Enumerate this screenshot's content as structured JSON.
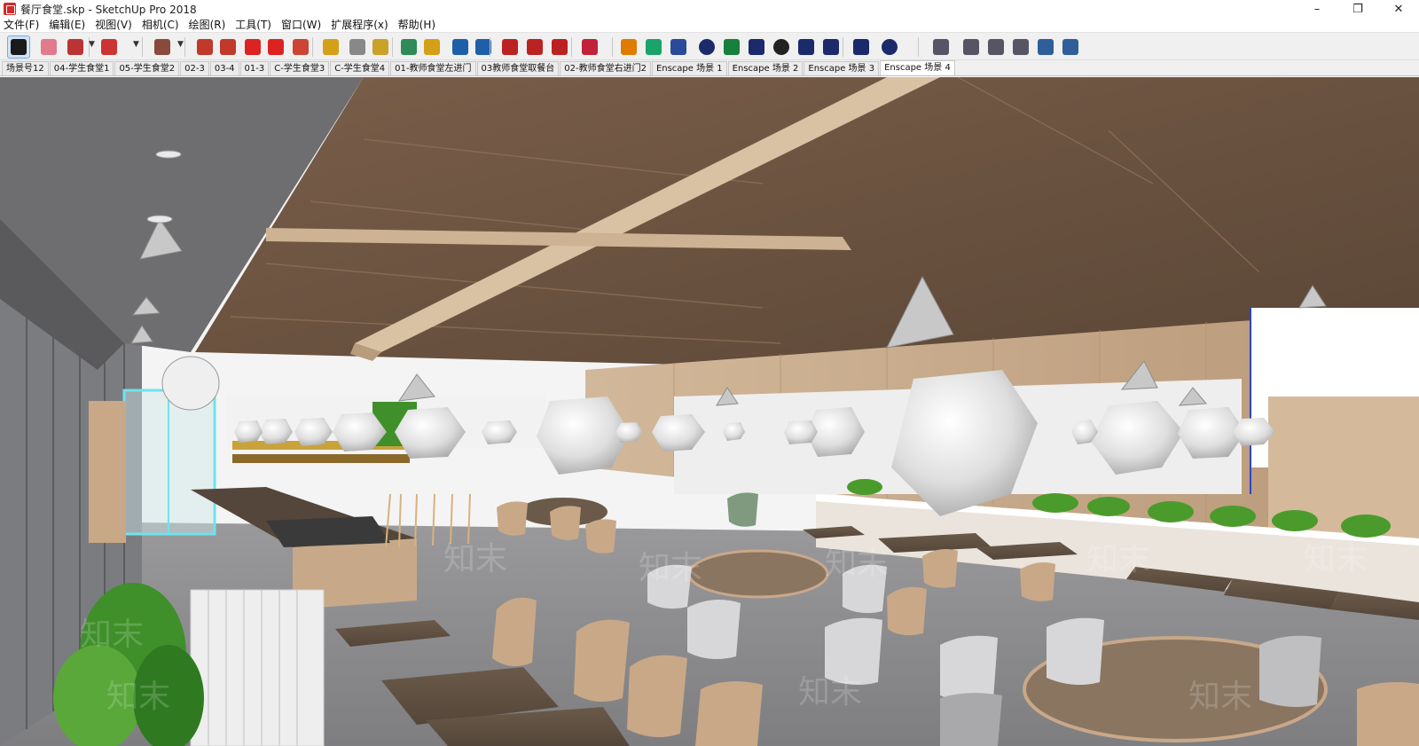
{
  "window": {
    "title": "餐厅食堂.skp - SketchUp Pro 2018",
    "controls": [
      "–",
      "❐",
      "✕"
    ]
  },
  "menu": [
    "文件(F)",
    "编辑(E)",
    "视图(V)",
    "相机(C)",
    "绘图(R)",
    "工具(T)",
    "窗口(W)",
    "扩展程序(x)",
    "帮助(H)"
  ],
  "toolbar": {
    "tools": [
      {
        "name": "select-tool-icon",
        "color": "#1a1a1a",
        "active": true
      },
      {
        "name": "eraser-tool-icon",
        "color": "#e07a8c"
      },
      {
        "name": "line-tool-icon",
        "color": "#b33"
      },
      {
        "name": "arc-tool-icon",
        "color": "#c33"
      },
      {
        "name": "rectangle-tool-icon",
        "color": "#8a4a3a"
      },
      {
        "name": "push-pull-tool-icon",
        "color": "#c0392b"
      },
      {
        "name": "offset-tool-icon",
        "color": "#c0392b"
      },
      {
        "name": "move-tool-icon",
        "color": "#d22"
      },
      {
        "name": "rotate-tool-icon",
        "color": "#d22"
      },
      {
        "name": "scale-tool-icon",
        "color": "#c43"
      },
      {
        "name": "tape-measure-icon",
        "color": "#d4a017"
      },
      {
        "name": "text-tool-icon",
        "color": "#888"
      },
      {
        "name": "paint-bucket-icon",
        "color": "#c9a227"
      },
      {
        "name": "orbit-tool-icon",
        "color": "#2e8b57"
      },
      {
        "name": "pan-tool-icon",
        "color": "#d4a017"
      },
      {
        "name": "zoom-tool-icon",
        "color": "#1f5fa8"
      },
      {
        "name": "zoom-extents-icon",
        "color": "#1f5fa8"
      },
      {
        "name": "warehouse-icon",
        "color": "#b22"
      },
      {
        "name": "extension-warehouse-icon",
        "color": "#b22"
      },
      {
        "name": "share-model-icon",
        "color": "#b22"
      },
      {
        "name": "ruby-console-icon",
        "color": "#c0223a"
      },
      {
        "name": "enscape-start-icon",
        "color": "#e07b00"
      },
      {
        "name": "enscape-sync-icon",
        "color": "#1aa36a"
      },
      {
        "name": "enscape-views-icon",
        "color": "#2a4a9a"
      },
      {
        "name": "enscape-add-icon",
        "color": "#1b2a6b"
      },
      {
        "name": "enscape-asset-icon",
        "color": "#16803c"
      },
      {
        "name": "enscape-material-icon",
        "color": "#1b2a6b"
      },
      {
        "name": "enscape-panorama-icon",
        "color": "#222"
      },
      {
        "name": "enscape-upload-icon",
        "color": "#1b2a6b"
      },
      {
        "name": "enscape-settings-icon",
        "color": "#1b2a6b"
      },
      {
        "name": "enscape-feedback-icon",
        "color": "#1b2a6b"
      },
      {
        "name": "enscape-info-icon",
        "color": "#1b2a6b"
      },
      {
        "name": "component-a-icon",
        "color": "#556"
      },
      {
        "name": "component-b-icon",
        "color": "#556"
      },
      {
        "name": "component-c-icon",
        "color": "#556"
      },
      {
        "name": "component-d-icon",
        "color": "#556"
      },
      {
        "name": "component-e-icon",
        "color": "#2f5e9a"
      },
      {
        "name": "component-f-icon",
        "color": "#2f5e9a"
      }
    ]
  },
  "scene_tabs": [
    {
      "label": "场景号12"
    },
    {
      "label": "04-学生食堂1"
    },
    {
      "label": "05-学生食堂2"
    },
    {
      "label": "02-3"
    },
    {
      "label": "03-4"
    },
    {
      "label": "01-3"
    },
    {
      "label": "C-学生食堂3"
    },
    {
      "label": "C-学生食堂4"
    },
    {
      "label": "01-教师食堂左进门"
    },
    {
      "label": "03教师食堂取餐台"
    },
    {
      "label": "02-教师食堂右进门2"
    },
    {
      "label": "Enscape 场景 1"
    },
    {
      "label": "Enscape 场景 2"
    },
    {
      "label": "Enscape 场景 3"
    },
    {
      "label": "Enscape 场景 4",
      "active": true
    }
  ],
  "viewport": {
    "watermark": "知末",
    "colors": {
      "ceiling_wood": "#6b5543",
      "wall_wood": "#c8ab8c",
      "floor": "#8d8d8f",
      "plant": "#3f8f2a"
    }
  }
}
